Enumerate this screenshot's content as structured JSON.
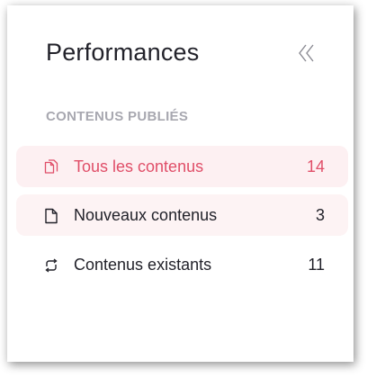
{
  "header": {
    "title": "Performances",
    "collapse_icon": "double-chevron-left-icon"
  },
  "section": {
    "label": "CONTENUS PUBLIÉS"
  },
  "items": [
    {
      "label": "Tous les contenus",
      "count": "14",
      "icon": "documents-icon",
      "active": true
    },
    {
      "label": "Nouveaux contenus",
      "count": "3",
      "icon": "document-icon",
      "active": false
    },
    {
      "label": "Contenus existants",
      "count": "11",
      "icon": "refresh-icon",
      "active": false
    }
  ],
  "colors": {
    "accent": "#e04e68",
    "active_bg": "#fdf0f2",
    "section_label": "#a8a8b0",
    "text": "#22222a"
  }
}
